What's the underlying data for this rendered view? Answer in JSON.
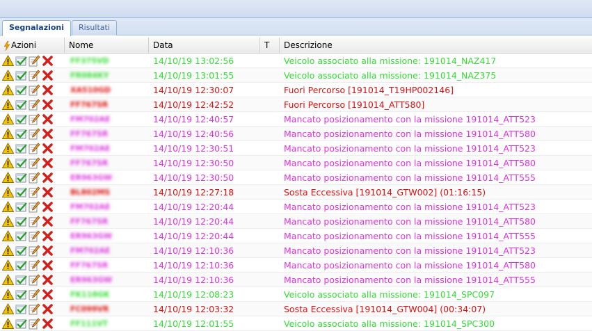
{
  "tabs": [
    {
      "label": "Segnalazioni",
      "active": true
    },
    {
      "label": "Risultati",
      "active": false
    }
  ],
  "columns": {
    "azioni": "Azioni",
    "nome": "Nome",
    "data": "Data",
    "t": "T",
    "descrizione": "Descrizione"
  },
  "colors": {
    "green": "#33dd33",
    "red": "#dd1111",
    "magenta": "#dd33dd"
  },
  "rows": [
    {
      "nome": "FF375VD",
      "data": "14/10/19 13:02:56",
      "descrizione": "Veicolo associato alla missione: 191014_NAZ417",
      "color": "#33dd33"
    },
    {
      "nome": "FR084KY",
      "data": "14/10/19 13:01:55",
      "descrizione": "Veicolo associato alla missione: 191014_NAZ375",
      "color": "#33dd33"
    },
    {
      "nome": "XA510GD",
      "data": "14/10/19 12:30:07",
      "descrizione": "Fuori Percorso [191014_T19HP002146]",
      "color": "#dd1111"
    },
    {
      "nome": "FF767SR",
      "data": "14/10/19 12:42:52",
      "descrizione": "Fuori Percorso [191014_ATT580]",
      "color": "#dd1111"
    },
    {
      "nome": "FM702AE",
      "data": "14/10/19 12:40:57",
      "descrizione": "Mancato posizionamento con la missione 191014_ATT523",
      "color": "#dd33dd"
    },
    {
      "nome": "FF767SR",
      "data": "14/10/19 12:40:56",
      "descrizione": "Mancato posizionamento con la missione 191014_ATT580",
      "color": "#dd33dd"
    },
    {
      "nome": "FM702AE",
      "data": "14/10/19 12:30:51",
      "descrizione": "Mancato posizionamento con la missione 191014_ATT523",
      "color": "#dd33dd"
    },
    {
      "nome": "FF767SR",
      "data": "14/10/19 12:30:50",
      "descrizione": "Mancato posizionamento con la missione 191014_ATT580",
      "color": "#dd33dd"
    },
    {
      "nome": "ER963GW",
      "data": "14/10/19 12:30:50",
      "descrizione": "Mancato posizionamento con la missione 191014_ATT555",
      "color": "#dd33dd"
    },
    {
      "nome": "BL802MS",
      "data": "14/10/19 12:27:18",
      "descrizione": "Sosta Eccessiva [191014_GTW002] (01:16:15)",
      "color": "#dd1111"
    },
    {
      "nome": "FM702AE",
      "data": "14/10/19 12:20:44",
      "descrizione": "Mancato posizionamento con la missione 191014_ATT523",
      "color": "#dd33dd"
    },
    {
      "nome": "FF767SR",
      "data": "14/10/19 12:20:44",
      "descrizione": "Mancato posizionamento con la missione 191014_ATT580",
      "color": "#dd33dd"
    },
    {
      "nome": "ER963GW",
      "data": "14/10/19 12:20:44",
      "descrizione": "Mancato posizionamento con la missione 191014_ATT555",
      "color": "#dd33dd"
    },
    {
      "nome": "FM702AE",
      "data": "14/10/19 12:10:36",
      "descrizione": "Mancato posizionamento con la missione 191014_ATT523",
      "color": "#dd33dd"
    },
    {
      "nome": "FF767SR",
      "data": "14/10/19 12:10:36",
      "descrizione": "Mancato posizionamento con la missione 191014_ATT580",
      "color": "#dd33dd"
    },
    {
      "nome": "ER963GW",
      "data": "14/10/19 12:10:36",
      "descrizione": "Mancato posizionamento con la missione 191014_ATT555",
      "color": "#dd33dd"
    },
    {
      "nome": "FK118GK",
      "data": "14/10/19 12:08:23",
      "descrizione": "Veicolo associato alla missione: 191014_SPC097",
      "color": "#33dd33"
    },
    {
      "nome": "FC099VR",
      "data": "14/10/19 12:03:32",
      "descrizione": "Sosta Eccessiva [191014_GTW004] (00:34:07)",
      "color": "#dd1111"
    },
    {
      "nome": "FF111VT",
      "data": "14/10/19 12:01:55",
      "descrizione": "Veicolo associato alla missione: 191014_SPC300",
      "color": "#33dd33"
    }
  ]
}
